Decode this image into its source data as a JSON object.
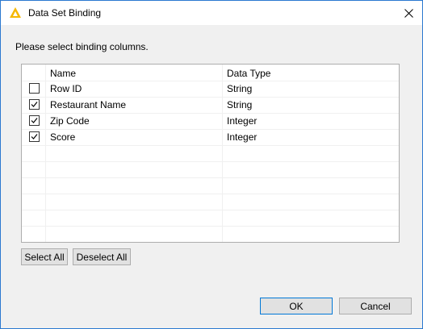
{
  "window": {
    "title": "Data Set Binding"
  },
  "prompt": "Please select binding columns.",
  "table": {
    "headers": {
      "name": "Name",
      "type": "Data Type"
    },
    "rows": [
      {
        "name": "Row ID",
        "type": "String",
        "checked": false
      },
      {
        "name": "Restaurant Name",
        "type": "String",
        "checked": true
      },
      {
        "name": "Zip Code",
        "type": "Integer",
        "checked": true
      },
      {
        "name": "Score",
        "type": "Integer",
        "checked": true
      }
    ]
  },
  "buttons": {
    "select_all": "Select All",
    "deselect_all": "Deselect All",
    "ok": "OK",
    "cancel": "Cancel"
  },
  "colors": {
    "accent": "#0078d7",
    "icon": "#f5b800"
  }
}
